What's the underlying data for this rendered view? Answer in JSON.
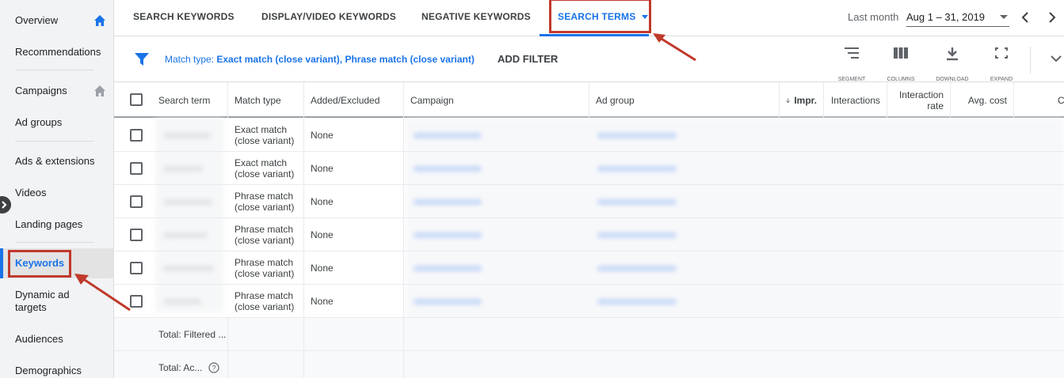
{
  "sidebar": {
    "items": [
      {
        "label": "Overview"
      },
      {
        "label": "Recommendations"
      },
      {
        "label": "Campaigns"
      },
      {
        "label": "Ad groups"
      },
      {
        "label": "Ads & extensions"
      },
      {
        "label": "Videos"
      },
      {
        "label": "Landing pages"
      },
      {
        "label": "Keywords"
      },
      {
        "label": "Dynamic ad targets"
      },
      {
        "label": "Audiences"
      },
      {
        "label": "Demographics"
      }
    ]
  },
  "tabs": [
    {
      "label": "SEARCH KEYWORDS"
    },
    {
      "label": "DISPLAY/VIDEO KEYWORDS"
    },
    {
      "label": "NEGATIVE KEYWORDS"
    },
    {
      "label": "SEARCH TERMS"
    }
  ],
  "date": {
    "label": "Last month",
    "range": "Aug 1 – 31, 2019"
  },
  "filter": {
    "prefix": "Match type: ",
    "value": "Exact match (close variant), Phrase match (close variant)",
    "add_label": "ADD FILTER"
  },
  "toolbar": {
    "segment": "SEGMENT",
    "columns": "COLUMNS",
    "download": "DOWNLOAD",
    "expand": "EXPAND"
  },
  "table": {
    "headers": {
      "search_term": "Search term",
      "match_type": "Match type",
      "added_excluded": "Added/Excluded",
      "campaign": "Campaign",
      "ad_group": "Ad group",
      "impr": "Impr.",
      "interactions": "Interactions",
      "interaction_rate": "Interaction rate",
      "avg_cost": "Avg. cost",
      "cost": "Co"
    },
    "rows": [
      {
        "match_type": "Exact match (close variant)",
        "added": "None"
      },
      {
        "match_type": "Exact match (close variant)",
        "added": "None"
      },
      {
        "match_type": "Phrase match (close variant)",
        "added": "None"
      },
      {
        "match_type": "Phrase match (close variant)",
        "added": "None"
      },
      {
        "match_type": "Phrase match (close variant)",
        "added": "None"
      },
      {
        "match_type": "Phrase match (close variant)",
        "added": "None"
      }
    ],
    "totals": [
      {
        "label": "Total: Filtered ..."
      },
      {
        "label": "Total: Ac..."
      }
    ]
  },
  "colors": {
    "accent": "#1a73e8",
    "callout": "#c0392b"
  }
}
